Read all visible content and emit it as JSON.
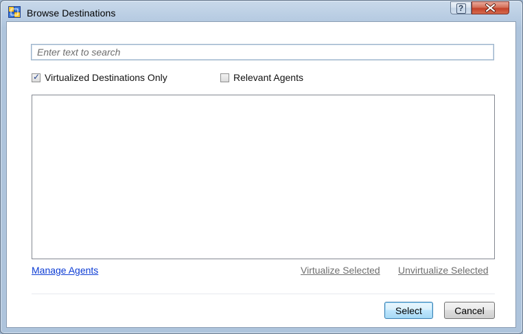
{
  "window": {
    "title": "Browse Destinations",
    "icon": "app-grid-icon"
  },
  "titlebar": {
    "help_label": "?",
    "close_label": "X"
  },
  "search": {
    "placeholder": "Enter text to search",
    "value": ""
  },
  "filters": {
    "virtualized_only": {
      "label": "Virtualized Destinations Only",
      "checked": true
    },
    "relevant_agents": {
      "label": "Relevant Agents",
      "checked": false
    }
  },
  "destinations_list": [],
  "links": {
    "manage_agents": "Manage Agents",
    "virtualize_selected": "Virtualize Selected",
    "unvirtualize_selected": "Unvirtualize Selected"
  },
  "buttons": {
    "select": "Select",
    "cancel": "Cancel"
  },
  "colors": {
    "link_blue": "#0b3bd4",
    "link_disabled": "#6d6d6d",
    "close_red": "#c4422a"
  }
}
